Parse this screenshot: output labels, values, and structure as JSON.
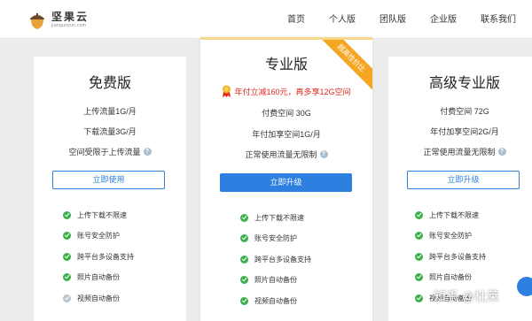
{
  "header": {
    "logo_cn": "坚果云",
    "logo_en": "jianguoyun.com",
    "nav": [
      "首页",
      "个人版",
      "团队版",
      "企业版",
      "联系我们"
    ]
  },
  "plans": {
    "free": {
      "title": "免费版",
      "lines": [
        "上传流量1G/月",
        "下载流量3G/月",
        "空间受限于上传流量"
      ],
      "button": "立即使用",
      "features": [
        "上传下载不限速",
        "账号安全防护",
        "跨平台多设备支持",
        "照片自动备份",
        "视频自动备份"
      ]
    },
    "pro": {
      "title": "专业版",
      "ribbon": "超高性价比",
      "promo": "年付立减160元，再多享12G空间",
      "lines": [
        "付费空间 30G",
        "年付加享空间1G/月",
        "正常使用流量无限制"
      ],
      "button": "立即升级",
      "features": [
        "上传下载不限速",
        "账号安全防护",
        "跨平台多设备支持",
        "照片自动备份",
        "视频自动备份"
      ]
    },
    "advanced": {
      "title": "高级专业版",
      "lines": [
        "付费空间 72G",
        "年付加享空间2G/月",
        "正常使用流量无限制"
      ],
      "button": "立即升级",
      "features": [
        "上传下载不限速",
        "账号安全防护",
        "跨平台多设备支持",
        "照片自动备份",
        "视频自动备份"
      ]
    }
  },
  "watermark": "知乎 @杜莱",
  "colors": {
    "accent": "#2d7fe0",
    "check": "#3fb14c",
    "ribbon": "#f5a623",
    "promo": "#e5291c"
  }
}
